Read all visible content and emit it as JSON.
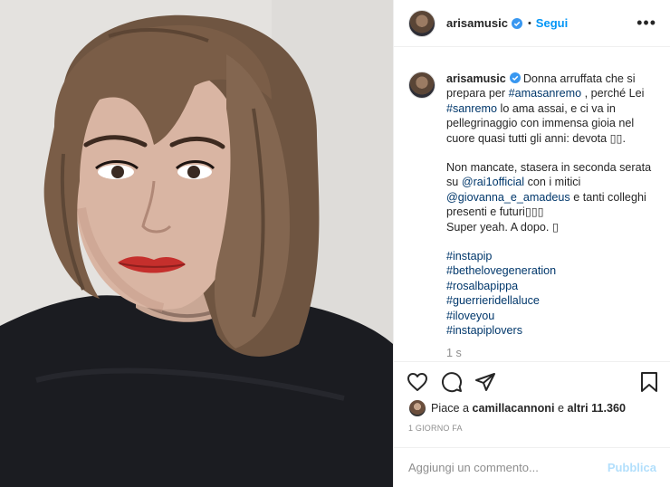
{
  "post": {
    "username": "arisamusic",
    "dot": "•",
    "follow_label": "Segui",
    "more_label": "•••"
  },
  "caption": {
    "username": "arisamusic",
    "text_1": "Donna arruffata che si prepara per ",
    "tag_amasanremo": "#amasanremo",
    "text_2": " , perché Lei ",
    "tag_sanremo": "#sanremo",
    "text_3": " lo ama assai, e ci va in pellegrinaggio con immensa gioia nel cuore quasi tutti gli anni: devota ",
    "emoji_1": "▯▯.",
    "text_4": "Non mancate, stasera in seconda serata su ",
    "mention_rai": "@rai1official",
    "text_5": " con i mitici ",
    "mention_amadeus": "@giovanna_e_amadeus",
    "text_6": " e tanti colleghi presenti e futuri",
    "emoji_2": "▯▯▯",
    "text_7": "Super yeah. A dopo. ",
    "emoji_3": "▯",
    "hashtags": [
      "#instapip",
      "#bethelovegeneration",
      "#rosalbapippa",
      "#guerrieridellaluce",
      "#iloveyou",
      "#instapiplovers"
    ],
    "cut_text": "1 s"
  },
  "likes": {
    "prefix": "Piace a ",
    "user": "camillacannoni",
    "middle": " e ",
    "others": "altri 11.360"
  },
  "timestamp": "1 GIORNO FA",
  "comment_box": {
    "placeholder": "Aggiungi un commento...",
    "publish_label": "Pubblica"
  },
  "colors": {
    "link": "#00376b",
    "follow": "#0095f6",
    "verified": "#3897f0",
    "publish_disabled": "#b2dffc"
  },
  "icons": [
    "verified-badge-icon",
    "heart-icon",
    "comment-icon",
    "share-icon",
    "bookmark-icon",
    "more-options-icon"
  ]
}
